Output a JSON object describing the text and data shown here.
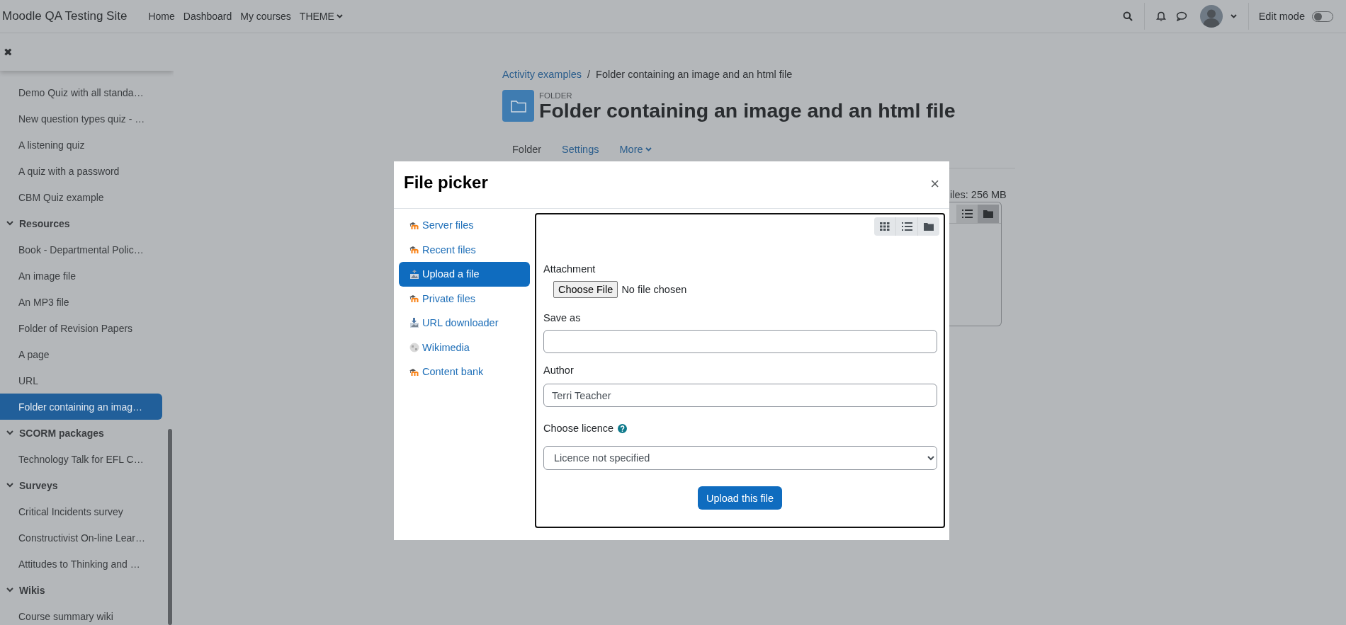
{
  "navbar": {
    "site_name": "Moodle QA Testing Site",
    "links": [
      {
        "label": "Home",
        "kind": "link"
      },
      {
        "label": "Dashboard",
        "kind": "link"
      },
      {
        "label": "My courses",
        "kind": "link"
      },
      {
        "label": "THEME",
        "kind": "dropdown"
      }
    ],
    "edit_mode": {
      "label": "Edit mode",
      "on": false
    }
  },
  "course_index": {
    "close": "✖",
    "sections": [
      {
        "children": [
          {
            "label": "Demo Quiz with all standa…",
            "selected": false
          },
          {
            "label": "New question types quiz - …",
            "selected": false
          },
          {
            "label": "A listening quiz",
            "selected": false
          },
          {
            "label": "A quiz with a password",
            "selected": false
          },
          {
            "label": "CBM Quiz example",
            "selected": false
          }
        ]
      },
      {
        "title": "Resources",
        "expanded": true,
        "children": [
          {
            "label": "Book - Departmental Polic…",
            "selected": false
          },
          {
            "label": "An image file",
            "selected": false
          },
          {
            "label": "An MP3 file",
            "selected": false
          },
          {
            "label": "Folder of Revision Papers",
            "selected": false
          },
          {
            "label": "A page",
            "selected": false
          },
          {
            "label": "URL",
            "selected": false
          },
          {
            "label": "Folder containing an imag…",
            "selected": true
          }
        ]
      },
      {
        "title": "SCORM packages",
        "expanded": true,
        "children": [
          {
            "label": "Technology Talk for EFL C…",
            "selected": false
          }
        ]
      },
      {
        "title": "Surveys",
        "expanded": true,
        "children": [
          {
            "label": "Critical Incidents survey",
            "selected": false
          },
          {
            "label": "Constructivist On-line Lear…",
            "selected": false
          },
          {
            "label": "Attitudes to Thinking and …",
            "selected": false
          }
        ]
      },
      {
        "title": "Wikis",
        "expanded": true,
        "children": [
          {
            "label": "Course summary wiki",
            "selected": false
          }
        ]
      }
    ]
  },
  "page": {
    "breadcrumb": [
      {
        "label": "Activity examples",
        "kind": "link"
      },
      {
        "label": "/",
        "kind": "separator"
      },
      {
        "label": "Folder containing an image and an html file",
        "kind": "current"
      }
    ],
    "module_type": "FOLDER",
    "title": "Folder containing an image and an html file",
    "tabs": [
      {
        "label": "Folder",
        "kind": "link",
        "selected": true
      },
      {
        "label": "Settings",
        "kind": "link",
        "selected": false
      },
      {
        "label": "More",
        "kind": "dropdown",
        "selected": false
      }
    ],
    "quota": "iles: 256 MB"
  },
  "file_picker": {
    "title": "File picker",
    "close": "×",
    "repositories": [
      {
        "label": "Server files",
        "kind": "moodle",
        "selected": false
      },
      {
        "label": "Recent files",
        "kind": "moodle",
        "selected": false
      },
      {
        "label": "Upload a file",
        "kind": "upload",
        "selected": true
      },
      {
        "label": "Private files",
        "kind": "moodle",
        "selected": false
      },
      {
        "label": "URL downloader",
        "kind": "download",
        "selected": false
      },
      {
        "label": "Wikimedia",
        "kind": "globe",
        "selected": false
      },
      {
        "label": "Content bank",
        "kind": "moodle",
        "selected": false
      }
    ],
    "form": {
      "attachment_label": "Attachment",
      "choose_button": "Choose File",
      "no_file": "No file chosen",
      "save_as_label": "Save as",
      "author_label": "Author",
      "author": "Terri Teacher",
      "licence_label": "Choose licence",
      "licence": "Licence not specified",
      "upload_button": "Upload this file"
    }
  }
}
